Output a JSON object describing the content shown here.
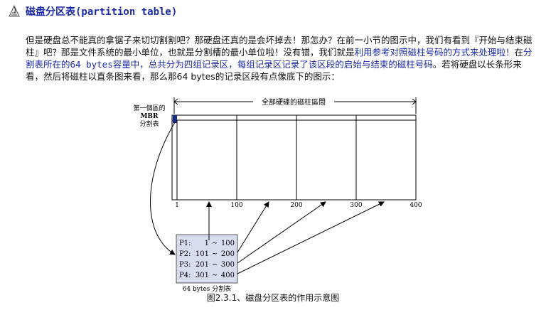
{
  "header": {
    "title": "磁盘分区表(partition table)",
    "icon": "paper-clip-document-icon"
  },
  "paragraph": {
    "p1": "但是硬盘总不能真的拿锯子来切切割割吧？那硬盘还真的是会坏掉去！那怎办？在前一小节的图示中，我们有看到『开始与结束磁柱』吧？那是文件系统的最小单位，也就是分割槽的最小单位啦！没有错，我们就是",
    "hl1": "利用参考对照磁柱号码的方式来处理啦！",
    "p2": "在",
    "hl2_a": "分割表所在的",
    "hl2_mono": "64 bytes",
    "hl2_b": "容量中，总共分为四组记录区，每组记录区记录了该区段的启始与结束的磁柱号码",
    "p3": "。若将硬盘以长条形来看，然后将磁柱以直条图来看，那么那64 bytes的记录区段有点像底下的图示："
  },
  "figure": {
    "mbr_label_line1": "第一個區的",
    "mbr_label_line2": "MBR",
    "mbr_label_line3": "分割表",
    "range_label": "全部硬碟的磁柱區間",
    "ticks": [
      "1",
      "100",
      "200",
      "300",
      "400"
    ],
    "table_rows": [
      {
        "part": "P1:",
        "start": "1",
        "end": "100"
      },
      {
        "part": "P2:",
        "start": "101",
        "end": "200"
      },
      {
        "part": "P3:",
        "start": "201",
        "end": "300"
      },
      {
        "part": "P4:",
        "start": "301",
        "end": "400"
      }
    ],
    "tilde": "~",
    "table_caption": "64 bytes 分割表",
    "caption": "图2.3.1、磁盘分区表的作用示意图",
    "colors": {
      "mbr_fill": "#1a2a8a",
      "table_fill": "#d7ddef",
      "line": "#000000"
    }
  }
}
